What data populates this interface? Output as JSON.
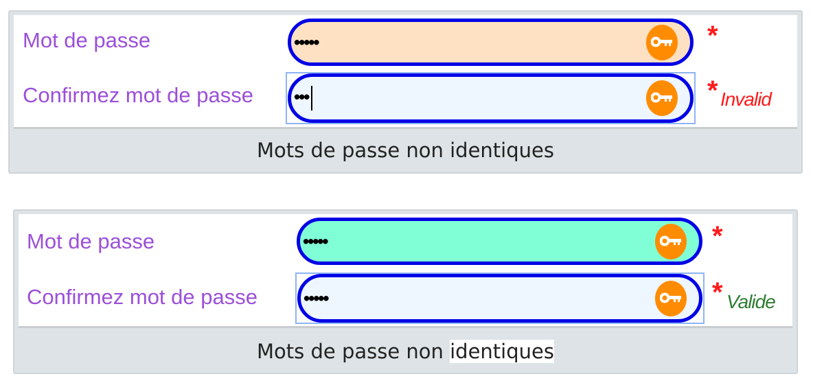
{
  "forms": [
    {
      "password_label": "Mot de passe",
      "password_value": "•••••",
      "confirm_label": "Confirmez mot de passe",
      "confirm_value": "•••",
      "required": "*",
      "status": "Invalid",
      "message_pre": "Mots de passe non ",
      "message_post": "identiques",
      "password_bg": "#fde1c2",
      "status_color": "#ff1a1a"
    },
    {
      "password_label": "Mot de passe",
      "password_value": "•••••",
      "confirm_label": "Confirmez mot de passe",
      "confirm_value": "•••••",
      "required": "*",
      "status": "Valide",
      "message_pre": "Mots de passe non ",
      "message_post": "identiques",
      "password_bg": "#80ffd6",
      "status_color": "#2e7d32"
    }
  ],
  "icons": {
    "field_icon": "key-icon"
  }
}
